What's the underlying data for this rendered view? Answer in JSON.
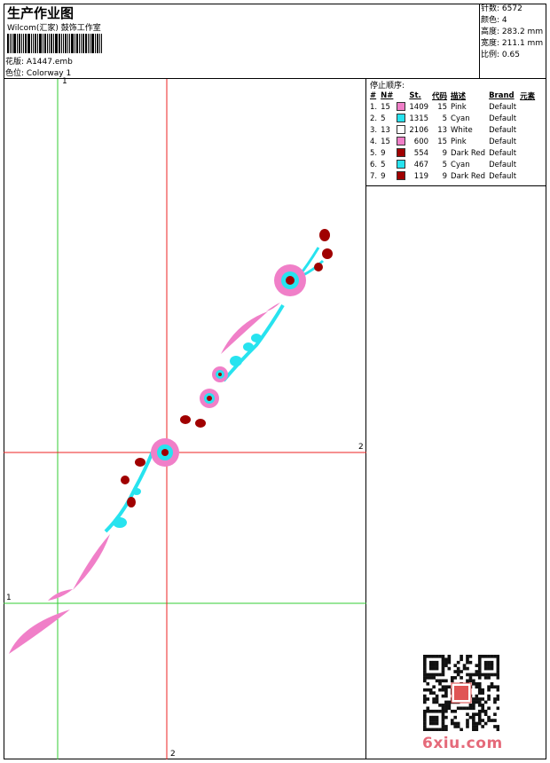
{
  "header": {
    "title": "生产作业图",
    "company": "Wilcom(汇家) 鼓饰工作室",
    "design_label": "花版:",
    "design_value": "A1447.emb",
    "colorway_label": "色位:",
    "colorway_value": "Colorway 1"
  },
  "stats": [
    {
      "label": "针数:",
      "value": "6572"
    },
    {
      "label": "颜色:",
      "value": "4"
    },
    {
      "label": "高度:",
      "value": "283.2 mm"
    },
    {
      "label": "宽度:",
      "value": "211.1 mm"
    },
    {
      "label": "比例:",
      "value": "0.65"
    }
  ],
  "stop_sequence": {
    "title": "停止顺序:",
    "columns": [
      "#",
      "N#",
      "St.",
      "代码",
      "描述",
      "Brand",
      "元素"
    ],
    "rows": [
      {
        "idx": "1.",
        "n": "15",
        "color": "#f07fc8",
        "st": "1409",
        "code": "15",
        "desc": "Pink",
        "brand": "Default"
      },
      {
        "idx": "2.",
        "n": "5",
        "color": "#27e3ef",
        "st": "1315",
        "code": "5",
        "desc": "Cyan",
        "brand": "Default"
      },
      {
        "idx": "3.",
        "n": "13",
        "color": "#ffffff",
        "st": "2106",
        "code": "13",
        "desc": "White",
        "brand": "Default"
      },
      {
        "idx": "4.",
        "n": "15",
        "color": "#f07fc8",
        "st": "600",
        "code": "15",
        "desc": "Pink",
        "brand": "Default"
      },
      {
        "idx": "5.",
        "n": "9",
        "color": "#a00000",
        "st": "554",
        "code": "9",
        "desc": "Dark Red",
        "brand": "Default"
      },
      {
        "idx": "6.",
        "n": "5",
        "color": "#27e3ef",
        "st": "467",
        "code": "5",
        "desc": "Cyan",
        "brand": "Default"
      },
      {
        "idx": "7.",
        "n": "9",
        "color": "#a00000",
        "st": "119",
        "code": "9",
        "desc": "Dark Red",
        "brand": "Default"
      }
    ]
  },
  "guides": {
    "v1": "1",
    "h1": "1",
    "v2": "2",
    "h2": "2"
  },
  "watermark": "6xiu.com",
  "colors": {
    "pink": "#f07fc8",
    "cyan": "#27e3ef",
    "dark_red": "#a00000",
    "guide_green": "#33cc33",
    "guide_red": "#ee2222"
  }
}
